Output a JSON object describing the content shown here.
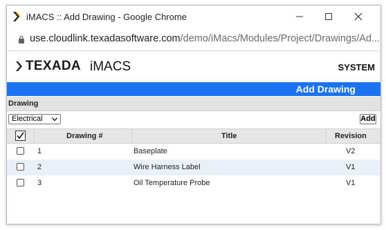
{
  "window": {
    "title": "iMACS :: Add Drawing - Google Chrome",
    "url_host": "use.cloudlink.texadasoftware.com",
    "url_path": "/demo/iMacs/Modules/Project/Drawings/Ad..."
  },
  "header": {
    "logo_text": "TEXADA",
    "app_name": "iMACS",
    "system_label": "SYSTEM"
  },
  "page_title": "Add Drawing",
  "section_label": "Drawing",
  "filter": {
    "selected": "Electrical"
  },
  "add_button_label": "Add",
  "table": {
    "columns": [
      "Drawing #",
      "Title",
      "Revision"
    ],
    "rows": [
      {
        "num": "1",
        "title": "Baseplate",
        "rev": "V2"
      },
      {
        "num": "2",
        "title": "Wire Harness Label",
        "rev": "V1"
      },
      {
        "num": "3",
        "title": "Oil Temperature Probe",
        "rev": "V1"
      }
    ]
  },
  "colors": {
    "accent_blue": "#1a73f0",
    "row_alt": "#eaf0f8"
  }
}
